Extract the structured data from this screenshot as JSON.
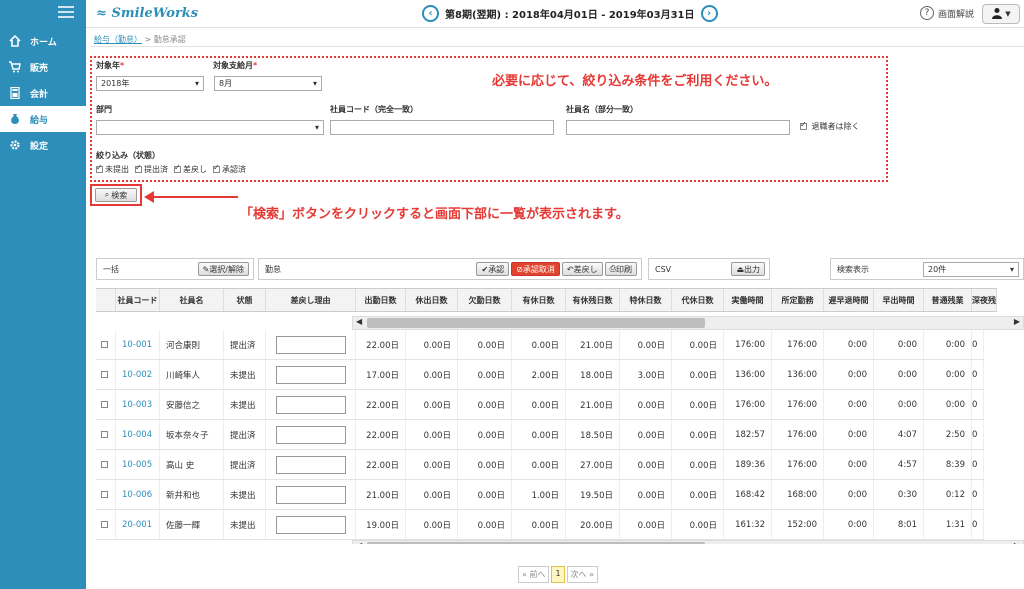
{
  "sidebar": {
    "menu_icon": "hamburger-icon",
    "items": [
      {
        "label": "ホーム",
        "icon": "home-icon"
      },
      {
        "label": "販売",
        "icon": "cart-icon"
      },
      {
        "label": "会計",
        "icon": "calculator-icon"
      },
      {
        "label": "給与",
        "icon": "moneybag-icon"
      },
      {
        "label": "設定",
        "icon": "gear-icon"
      }
    ]
  },
  "topbar": {
    "logo": "SmileWorks",
    "period": "第8期(翌期) : 2018年04月01日 - 2019年03月31日",
    "help": "画面解説"
  },
  "breadcrumb": {
    "parent": "給与（勤怠）",
    "sep": ">",
    "current": "勤怠承認"
  },
  "filter": {
    "year_label": "対象年",
    "year_value": "2018年",
    "month_label": "対象支給月",
    "month_value": "8月",
    "req_mark": "*",
    "dept_label": "部門",
    "dept_value": "",
    "code_label": "社員コード（完全一致）",
    "name_label": "社員名（部分一致）",
    "exclude_retired": "退職者は除く",
    "status_label": "絞り込み（状態）",
    "status_options": [
      "未提出",
      "提出済",
      "差戻し",
      "承認済"
    ],
    "search_button": "検索"
  },
  "annotations": {
    "filter_note": "必要に応じて、絞り込み条件をご利用ください。",
    "search_note": "「検索」ボタンをクリックすると画面下部に一覧が表示されます。"
  },
  "toolbar": {
    "bulk_label": "一括",
    "select_clear": "選択/解除",
    "attendance_label": "勤怠",
    "approve": "承認",
    "cancel_approve": "承認取消",
    "send_back": "差戻し",
    "print": "印刷",
    "csv_label": "CSV",
    "output": "出力",
    "display_label": "検索表示",
    "display_value": "20件"
  },
  "table": {
    "columns": [
      "社員コード",
      "社員名",
      "状態",
      "差戻し理由",
      "出勤日数",
      "休出日数",
      "欠勤日数",
      "有休日数",
      "有休残日数",
      "特休日数",
      "代休日数",
      "実働時間",
      "所定勤務",
      "遅早退時間",
      "早出時間",
      "普通残業",
      "深夜残"
    ],
    "rows": [
      [
        "10-001",
        "河合康則",
        "提出済",
        "",
        "22.00日",
        "0.00日",
        "0.00日",
        "0.00日",
        "21.00日",
        "0.00日",
        "0.00日",
        "176:00",
        "176:00",
        "0:00",
        "0:00",
        "0:00",
        "0"
      ],
      [
        "10-002",
        "川崎隼人",
        "未提出",
        "",
        "17.00日",
        "0.00日",
        "0.00日",
        "2.00日",
        "18.00日",
        "3.00日",
        "0.00日",
        "136:00",
        "136:00",
        "0:00",
        "0:00",
        "0:00",
        "0"
      ],
      [
        "10-003",
        "安藤信之",
        "未提出",
        "",
        "22.00日",
        "0.00日",
        "0.00日",
        "0.00日",
        "21.00日",
        "0.00日",
        "0.00日",
        "176:00",
        "176:00",
        "0:00",
        "0:00",
        "0:00",
        "0"
      ],
      [
        "10-004",
        "坂本奈々子",
        "提出済",
        "",
        "22.00日",
        "0.00日",
        "0.00日",
        "0.00日",
        "18.50日",
        "0.00日",
        "0.00日",
        "182:57",
        "176:00",
        "0:00",
        "4:07",
        "2:50",
        "0"
      ],
      [
        "10-005",
        "高山 史",
        "提出済",
        "",
        "22.00日",
        "0.00日",
        "0.00日",
        "0.00日",
        "27.00日",
        "0.00日",
        "0.00日",
        "189:36",
        "176:00",
        "0:00",
        "4:57",
        "8:39",
        "0"
      ],
      [
        "10-006",
        "新井和也",
        "未提出",
        "",
        "21.00日",
        "0.00日",
        "0.00日",
        "1.00日",
        "19.50日",
        "0.00日",
        "0.00日",
        "168:42",
        "168:00",
        "0:00",
        "0:30",
        "0:12",
        "0"
      ],
      [
        "20-001",
        "佐藤一輝",
        "未提出",
        "",
        "19.00日",
        "0.00日",
        "0.00日",
        "0.00日",
        "20.00日",
        "0.00日",
        "0.00日",
        "161:32",
        "152:00",
        "0:00",
        "8:01",
        "1:31",
        "0"
      ]
    ]
  },
  "pager": {
    "prev": "« 前へ",
    "page": "1",
    "next": "次へ »"
  }
}
